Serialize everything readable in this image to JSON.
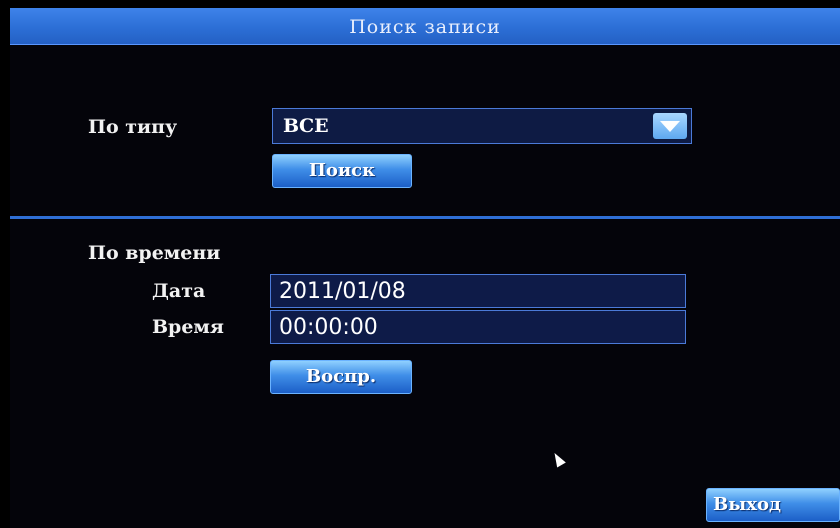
{
  "title": "Поиск записи",
  "type_search": {
    "label": "По типу",
    "selected": "ВСЕ",
    "search_button": "Поиск"
  },
  "time_search": {
    "label": "По времени",
    "date_label": "Дата",
    "date_value": "2011/01/08",
    "time_label": "Время",
    "time_value": "00:00:00",
    "play_button": "Воспр."
  },
  "exit_button": "Выход",
  "colors": {
    "title_bar": "#2c6fd6",
    "background": "#04040a",
    "field_bg": "#0e1b44",
    "button_accent": "#3f8ee8"
  }
}
